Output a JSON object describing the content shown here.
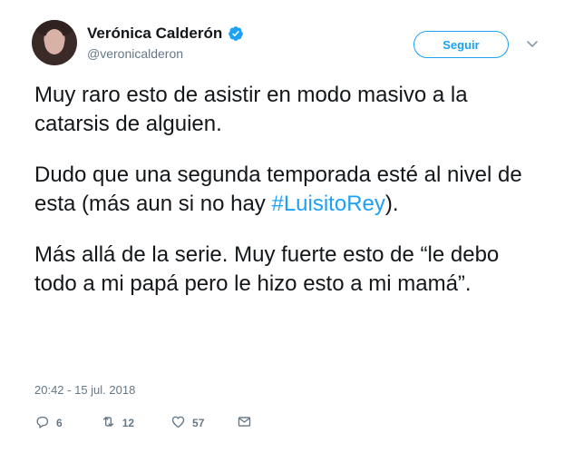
{
  "author": {
    "display_name": "Verónica Calderón",
    "handle": "@veronicalderon"
  },
  "follow_button": {
    "label": "Seguir"
  },
  "tweet": {
    "paragraph_1": "Muy raro esto de asistir en modo masivo a la catarsis de alguien.",
    "paragraph_2_before": "Dudo que una segunda temporada esté al nivel de esta (más aun si no hay ",
    "hashtag": "#LuisitoRey",
    "paragraph_2_after": ").",
    "paragraph_3": "Más allá de la serie. Muy fuerte esto de “le debo todo a mi papá pero le hizo esto a mi mamá”.",
    "timestamp": "20:42 - 15 jul. 2018"
  },
  "stats": {
    "replies": "6",
    "retweets": "12",
    "likes": "57"
  },
  "icons": {
    "verified": "verified-badge-icon",
    "caret": "chevron-down-icon",
    "reply": "reply-icon",
    "retweet": "retweet-icon",
    "like": "heart-icon",
    "message": "envelope-icon"
  },
  "colors": {
    "accent": "#1da1f2",
    "text": "#14171a",
    "muted": "#657786"
  }
}
